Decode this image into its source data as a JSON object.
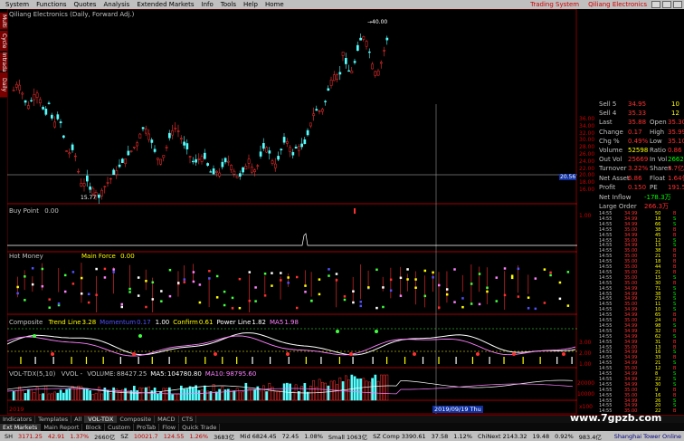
{
  "menu": {
    "items": [
      "System",
      "Functions",
      "Quotes",
      "Analysis",
      "Extended Markets",
      "Info",
      "Tools",
      "Help",
      "Home"
    ],
    "links": [
      "Trading System",
      "Qiliang Electronics"
    ]
  },
  "left_tabs": [
    "Multi",
    "Cycle",
    "Intraday",
    "Daily"
  ],
  "title_label": "Qiliang Electronics (Daily, Forward Adj.)",
  "price_marks": {
    "high": "→40.00",
    "low": "15.77"
  },
  "price_axis": [
    "36.00",
    "34.00",
    "32.00",
    "30.00",
    "28.00",
    "26.00",
    "24.00",
    "22.00",
    "20.00",
    "18.00",
    "16.00"
  ],
  "price_axis_highlight": "20.56",
  "panels": {
    "p1": {
      "title": "Buy Point",
      "value": "0.00",
      "axis": "1.00"
    },
    "p2": {
      "title": "Hot Money",
      "sub": "Main Force",
      "value": "0.00"
    },
    "p3": {
      "title": "Composite",
      "items": [
        {
          "label": "Trend Line",
          "value": "3.28"
        },
        {
          "label": "Momentum",
          "value": "0.17"
        },
        {
          "label": "",
          "value": "1.00"
        },
        {
          "label": "Confirm",
          "value": "0.61"
        },
        {
          "label": "Power Line",
          "value": "1.82"
        },
        {
          "label": "MA5",
          "value": "1.98"
        }
      ],
      "axis": [
        "3.00",
        "2.00",
        "1.00"
      ]
    },
    "p4": {
      "title": "VOL-TDX(5,10)",
      "items": [
        {
          "label": "VVOL -",
          "value": ""
        },
        {
          "label": "VOLUME:",
          "value": "88427.25"
        },
        {
          "label": "MA5:",
          "value": "104780.80"
        },
        {
          "label": "MA10:",
          "value": "98795.60"
        }
      ],
      "axis": [
        "20000",
        "10000"
      ],
      "unit": "x100"
    }
  },
  "date_label": "2019/09/19 Thu",
  "x_axis_year": "2019",
  "quote": {
    "rows": [
      {
        "k": "Sell 5",
        "v": "34.95",
        "n": "10"
      },
      {
        "k": "Sell 4",
        "v": "35.33",
        "n": "12"
      },
      {
        "k": "Last",
        "v": "35.88",
        "k2": "Open",
        "v2": "35.30"
      },
      {
        "k": "Change",
        "v": "0.17",
        "k2": "High",
        "v2": "35.99"
      },
      {
        "k": "Chg %",
        "v": "0.49%",
        "k2": "Low",
        "v2": "35.10"
      },
      {
        "k": "Volume",
        "v": "52598",
        "k2": "Ratio",
        "v2": "0.86"
      },
      {
        "k": "Out Vol",
        "v": "25669",
        "k2": "In Vol",
        "v2": "26621"
      },
      {
        "k": "Turnover",
        "v": "3.22%",
        "k2": "Shares",
        "v2": "3.7亿"
      },
      {
        "k": "Net Asset",
        "v": "6.86",
        "k2": "Float",
        "v2": "1.64亿"
      },
      {
        "k": "Profit",
        "v": "0.150",
        "k2": "PE",
        "v2": "191.5"
      }
    ],
    "net_in": {
      "k": "Net Inflow",
      "v": "-178.3万"
    },
    "big_in": {
      "k": "Large Order",
      "v": "266.3万"
    },
    "ticks": [
      [
        "14:55",
        "34.99",
        "50",
        "B"
      ],
      [
        "14:55",
        "34.99",
        "18",
        "S"
      ],
      [
        "14:55",
        "34.99",
        "66",
        "S"
      ],
      [
        "14:55",
        "35.00",
        "38",
        "B"
      ],
      [
        "14:55",
        "34.99",
        "45",
        "B"
      ],
      [
        "14:55",
        "35.00",
        "12",
        "S"
      ],
      [
        "14:55",
        "34.99",
        "13",
        "S"
      ],
      [
        "14:55",
        "35.00",
        "38",
        "B"
      ],
      [
        "14:55",
        "35.00",
        "21",
        "B"
      ],
      [
        "14:55",
        "35.00",
        "18",
        "B"
      ],
      [
        "14:55",
        "35.00",
        "44",
        "B"
      ],
      [
        "14:55",
        "35.00",
        "21",
        "B"
      ],
      [
        "14:55",
        "35.00",
        "15",
        "S"
      ],
      [
        "14:55",
        "35.00",
        "30",
        "B"
      ],
      [
        "14:55",
        "34.99",
        "71",
        "S"
      ],
      [
        "14:55",
        "34.99",
        "38",
        "S"
      ],
      [
        "14:55",
        "34.99",
        "23",
        "S"
      ],
      [
        "14:55",
        "35.00",
        "11",
        "S"
      ],
      [
        "14:55",
        "34.99",
        "10",
        "S"
      ],
      [
        "14:55",
        "34.99",
        "65",
        "B"
      ],
      [
        "14:55",
        "35.00",
        "24",
        "B"
      ],
      [
        "14:55",
        "34.99",
        "98",
        "S"
      ],
      [
        "14:55",
        "34.99",
        "32",
        "B"
      ],
      [
        "14:55",
        "34.99",
        "62",
        "S"
      ],
      [
        "14:55",
        "34.99",
        "31",
        "B"
      ],
      [
        "14:55",
        "35.00",
        "13",
        "B"
      ],
      [
        "14:55",
        "34.99",
        "16",
        "S"
      ],
      [
        "14:55",
        "34.99",
        "33",
        "B"
      ],
      [
        "14:55",
        "34.99",
        "21",
        "S"
      ],
      [
        "14:55",
        "35.00",
        "12",
        "B"
      ],
      [
        "14:55",
        "34.99",
        "8",
        "S"
      ],
      [
        "14:55",
        "34.99",
        "22",
        "S"
      ],
      [
        "14:55",
        "34.99",
        "30",
        "S"
      ],
      [
        "14:55",
        "35.00",
        "9",
        "B"
      ],
      [
        "14:55",
        "35.00",
        "16",
        "B"
      ],
      [
        "14:55",
        "34.99",
        "26",
        "S"
      ],
      [
        "14:55",
        "34.99",
        "20",
        "S"
      ],
      [
        "14:55",
        "35.00",
        "22",
        "B"
      ]
    ]
  },
  "tabs_row1": [
    "Indicators",
    "Templates",
    "All",
    "VOL-TDX",
    "Composite",
    "MACD",
    "CTS"
  ],
  "tabs_row2": [
    "Ext Markets",
    "Main Report",
    "Block",
    "Custom",
    "ProTab",
    "Flow",
    "Quick Trade"
  ],
  "status": {
    "sh": {
      "label": "SH",
      "value": "3171.25",
      "chg": "42.91",
      "pct": "1.37%",
      "amt": "2660亿"
    },
    "sz": {
      "label": "SZ",
      "value": "10021.7",
      "chg": "124.55",
      "pct": "1.26%",
      "amt": "3683亿"
    },
    "tail": [
      "Mid 6824.45",
      "72.45",
      "1.08%",
      "Small 1063亿",
      "SZ Comp 3390.61",
      "37.58",
      "1.12%",
      "ChiNext 2143.32",
      "19.48",
      "0.92%",
      "983.4亿"
    ],
    "right": "Shanghai Tower Online"
  },
  "watermark": "www.7gpzb.com",
  "chart_data": {
    "type": "candlestick",
    "series_visible": [
      "price",
      "buy_point",
      "hot_money",
      "composite",
      "volume"
    ],
    "price_range": [
      15.5,
      41
    ],
    "extreme_high": 40.0,
    "extreme_low": 15.77
  }
}
